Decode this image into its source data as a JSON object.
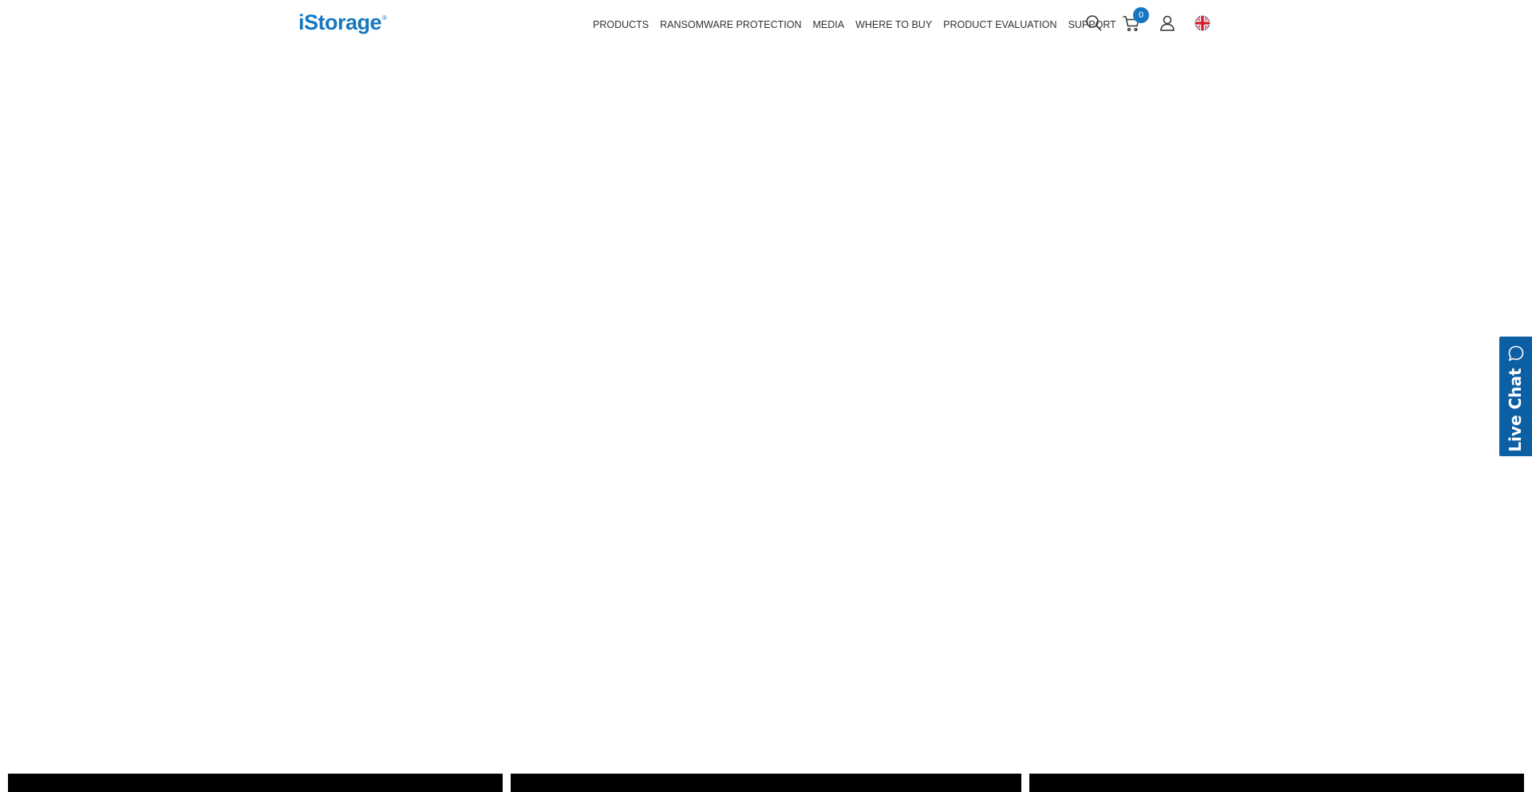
{
  "header": {
    "logo": {
      "text": "iStorage",
      "reg_mark": "®",
      "brand_color": "#1577c0"
    },
    "nav": [
      {
        "label": "PRODUCTS"
      },
      {
        "label": "RANSOMWARE PROTECTION"
      },
      {
        "label": "MEDIA"
      },
      {
        "label": "WHERE TO BUY"
      },
      {
        "label": "PRODUCT EVALUATION"
      },
      {
        "label": "SUPPORT"
      }
    ],
    "icons": {
      "search": "search-icon",
      "cart": "cart-icon",
      "account": "user-icon",
      "language": "uk-flag-icon"
    },
    "cart_count": "0"
  },
  "live_chat": {
    "label": "Live Chat",
    "icon": "chat-bubble-icon",
    "color": "#0d5fa3"
  }
}
